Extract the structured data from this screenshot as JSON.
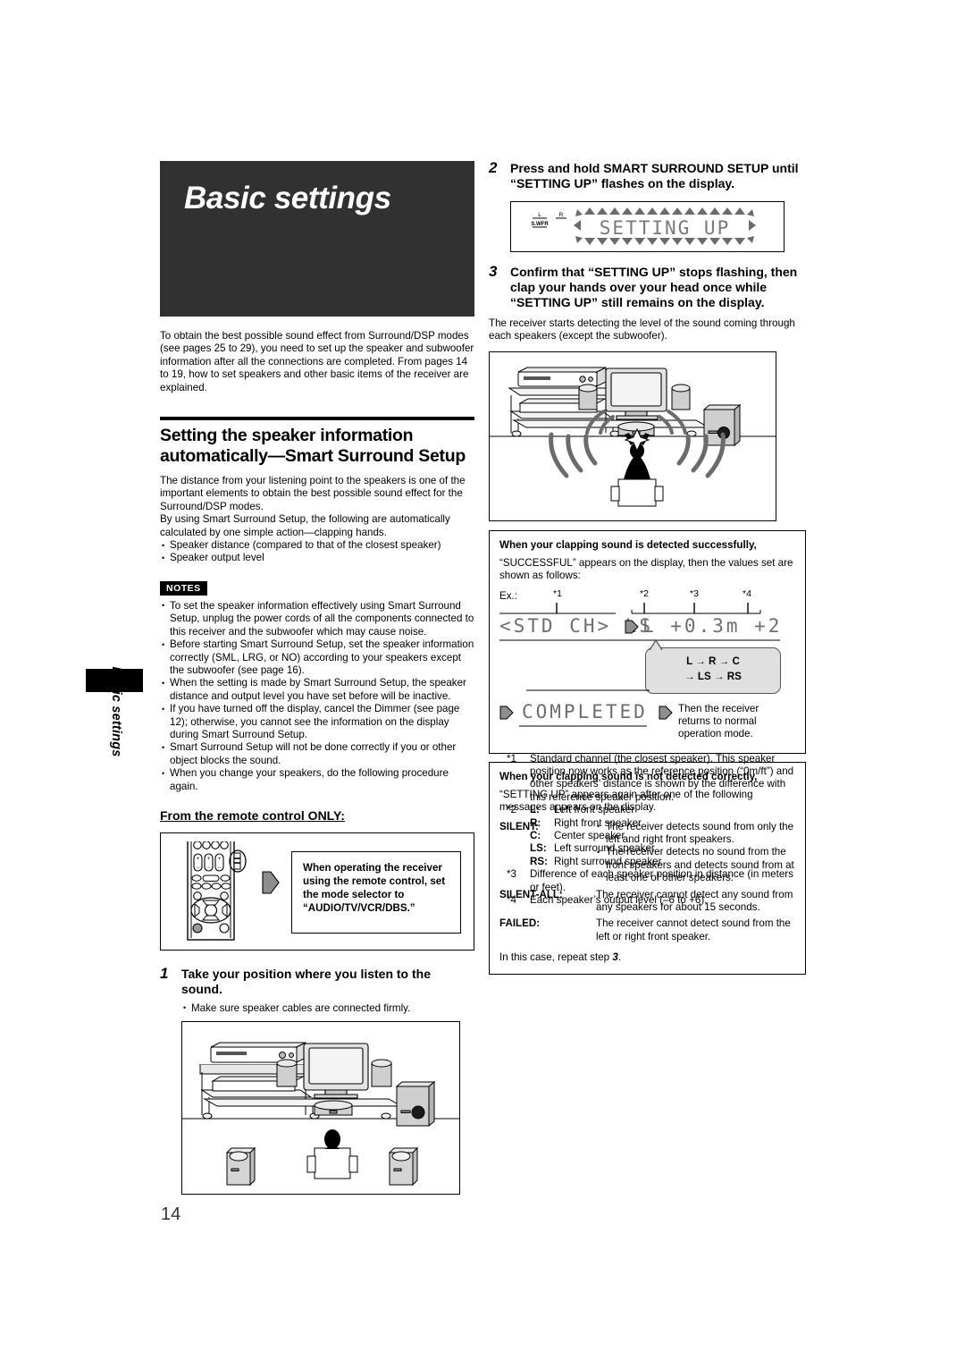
{
  "page": {
    "number": "14",
    "side_tab_label": "Basic settings",
    "chapter_title": "Basic settings"
  },
  "intro": {
    "paragraph": "To obtain the best possible sound effect from Surround/DSP modes (see pages 25 to 29), you need to set up the speaker and subwoofer information after all the connections are completed. From pages 14 to 19, how to set speakers and other basic items of the receiver are explained."
  },
  "section": {
    "heading": "Setting the speaker information automatically—Smart Surround Setup",
    "paragraph1": "The distance from your listening point to the speakers is one of the important elements to obtain the best possible sound effect for the Surround/DSP modes.",
    "paragraph2": "By using Smart Surround Setup, the following are automatically calculated by one simple action—clapping hands.",
    "bullets": [
      "Speaker distance (compared to that of the closest speaker)",
      "Speaker output level"
    ]
  },
  "notes": {
    "badge": "NOTES",
    "items": [
      "To set the speaker information effectively using Smart Surround Setup, unplug the power cords of all the components connected to this receiver and the subwoofer which may cause noise.",
      "Before starting Smart Surround Setup, set the speaker information correctly (SML, LRG, or NO) according to your speakers except the subwoofer (see page 16).",
      "When the setting is made by Smart Surround Setup, the speaker distance and output level you have set before will be inactive.",
      "If you have turned off the display, cancel the Dimmer (see page 12); otherwise, you cannot see the information on the display during Smart Surround Setup.",
      "Smart Surround Setup will not be done correctly if you or other object blocks the sound.",
      "When you change your speakers, do the following procedure again."
    ]
  },
  "remote": {
    "subheading": "From the remote control ONLY:",
    "callout_line1": "When operating the receiver",
    "callout_line2": "using the remote control, set",
    "callout_line3": "the mode selector to",
    "callout_line4": "“AUDIO/TV/VCR/DBS.”"
  },
  "steps": [
    {
      "number": "1",
      "title": "Take your position where you listen to the sound.",
      "bullet": "Make sure speaker cables are connected firmly."
    },
    {
      "number": "2",
      "title": "Press and hold SMART SURROUND SETUP until “SETTING UP” flashes on the display."
    },
    {
      "number": "3",
      "title": "Confirm that “SETTING UP” stops flashing, then clap your hands over your head once while “SETTING UP” still remains on the display.",
      "body": "The receiver starts detecting the level of the sound coming through each speakers (except the subwoofer)."
    }
  ],
  "display": {
    "indicator_l": "L",
    "indicator_r": "R",
    "indicator_swfr": "S.WFR",
    "text": "SETTING UP"
  },
  "success": {
    "heading": "When your clapping sound is detected successfully,",
    "paragraph": "“SUCCESSFUL” appears on the display, then the values set are shown as follows:",
    "ex_label": "Ex.:",
    "marks": {
      "m1": "*1",
      "m2": "*2",
      "m3": "*3",
      "m4": "*4"
    },
    "lcd_left": "<STD CH> LS",
    "lcd_right": "L +0.3m +2",
    "lcd_completed": "COMPLETED",
    "cycle_line1": "L  →  R  →  C",
    "cycle_line2": "→ LS → RS",
    "then_text": "Then the receiver returns to normal operation mode.",
    "footnotes": [
      {
        "mark": "*1",
        "text": "Standard channel (the closest speaker). This speaker position now works as the reference position (“0m/ft”) and other speakers’ distance is shown by the difference with this reference speaker position."
      },
      {
        "mark": "*3",
        "text": "Difference of each speaker position in distance (in meters or feet)."
      },
      {
        "mark": "*4",
        "text": "Each speaker’s output level (–6 to +6)."
      }
    ],
    "footnote2_mark": "*2",
    "speakers": [
      {
        "key": "L:",
        "desc": "Left front speaker"
      },
      {
        "key": "R:",
        "desc": "Right front speaker"
      },
      {
        "key": "C:",
        "desc": "Center speaker"
      },
      {
        "key": "LS:",
        "desc": "Left surround speaker"
      },
      {
        "key": "RS:",
        "desc": "Right surround speaker"
      }
    ]
  },
  "failure": {
    "heading": "When your clapping sound is not detected correctly,",
    "paragraph": "“SETTING UP” appears again after one of the following messages appears on the display.",
    "messages": [
      {
        "key": "SILENT:",
        "bullets": [
          "The receiver detects sound from only the left and right front speakers.",
          "The receiver detects no sound from the front speakers and detects sound from at least one of other speakers."
        ]
      },
      {
        "key": "SILENT-ALL:",
        "plain": "The receiver cannot detect any sound from any speakers for about 15 seconds."
      },
      {
        "key": "FAILED:",
        "plain": "The receiver cannot detect sound from the left or right front speaker."
      }
    ],
    "repeat_prefix": "In this case, repeat step ",
    "repeat_step": "3",
    "repeat_suffix": "."
  }
}
